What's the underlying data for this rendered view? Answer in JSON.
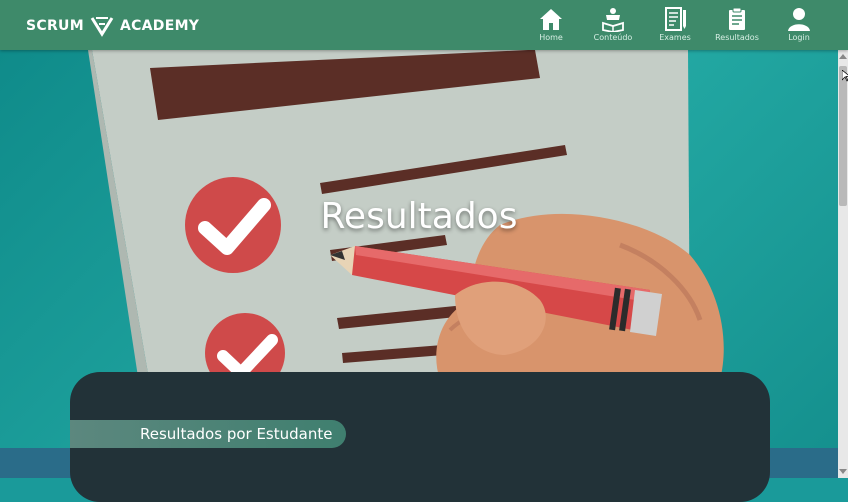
{
  "brand": {
    "left": "SCRUM",
    "right": "ACADEMY"
  },
  "nav": [
    {
      "label": "Home",
      "icon": "home-icon"
    },
    {
      "label": "Conteúdo",
      "icon": "book-reader-icon"
    },
    {
      "label": "Exames",
      "icon": "exam-notebook-icon"
    },
    {
      "label": "Resultados",
      "icon": "clipboard-icon"
    },
    {
      "label": "Login",
      "icon": "user-icon"
    }
  ],
  "hero": {
    "title": "Resultados"
  },
  "section": {
    "pill_label": "Resultados por Estudante"
  },
  "colors": {
    "topbar": "#3e8a6a",
    "hero_background": "#1a9a9a",
    "panel": "#223238",
    "pill": "#3f7f6f",
    "check_red": "#d04848"
  }
}
